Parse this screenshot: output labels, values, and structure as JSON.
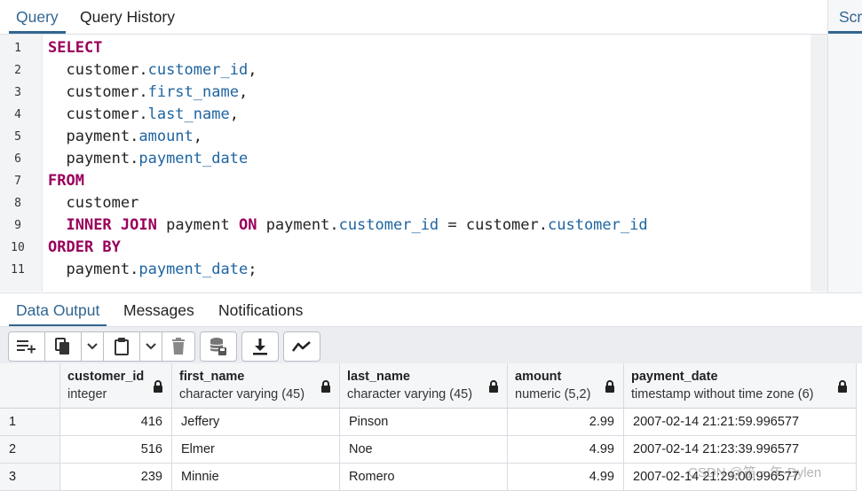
{
  "top_tabs": {
    "query": "Query",
    "history": "Query History",
    "scratch": "Scr"
  },
  "editor": {
    "line_numbers": [
      "1",
      "2",
      "3",
      "4",
      "5",
      "6",
      "7",
      "8",
      "9",
      "10",
      "11"
    ],
    "lines": [
      [
        {
          "t": "SELECT",
          "c": "kw"
        }
      ],
      [
        {
          "t": "  customer."
        },
        {
          "t": "customer_id",
          "c": "prop"
        },
        {
          "t": ","
        }
      ],
      [
        {
          "t": "  customer."
        },
        {
          "t": "first_name",
          "c": "prop"
        },
        {
          "t": ","
        }
      ],
      [
        {
          "t": "  customer."
        },
        {
          "t": "last_name",
          "c": "prop"
        },
        {
          "t": ","
        }
      ],
      [
        {
          "t": "  payment."
        },
        {
          "t": "amount",
          "c": "prop"
        },
        {
          "t": ","
        }
      ],
      [
        {
          "t": "  payment."
        },
        {
          "t": "payment_date",
          "c": "prop"
        }
      ],
      [
        {
          "t": "FROM",
          "c": "kw"
        }
      ],
      [
        {
          "t": "  customer"
        }
      ],
      [
        {
          "t": "  "
        },
        {
          "t": "INNER JOIN",
          "c": "kw"
        },
        {
          "t": " payment "
        },
        {
          "t": "ON",
          "c": "kw"
        },
        {
          "t": " payment."
        },
        {
          "t": "customer_id",
          "c": "prop"
        },
        {
          "t": " = customer."
        },
        {
          "t": "customer_id",
          "c": "prop"
        }
      ],
      [
        {
          "t": "ORDER BY",
          "c": "kw"
        }
      ],
      [
        {
          "t": "  payment."
        },
        {
          "t": "payment_date",
          "c": "prop"
        },
        {
          "t": ";"
        }
      ]
    ]
  },
  "bottom_tabs": {
    "data_output": "Data Output",
    "messages": "Messages",
    "notifications": "Notifications"
  },
  "toolbar": {
    "icons": [
      "add-row-icon",
      "copy-icon",
      "copy-dropdown-icon",
      "paste-icon",
      "paste-dropdown-icon",
      "delete-icon",
      "save-data-icon",
      "download-icon",
      "graph-icon"
    ]
  },
  "table": {
    "columns": [
      {
        "name": "customer_id",
        "type": "integer"
      },
      {
        "name": "first_name",
        "type": "character varying (45)"
      },
      {
        "name": "last_name",
        "type": "character varying (45)"
      },
      {
        "name": "amount",
        "type": "numeric (5,2)"
      },
      {
        "name": "payment_date",
        "type": "timestamp without time zone (6)"
      }
    ],
    "rows": [
      {
        "n": "1",
        "customer_id": "416",
        "first_name": "Jeffery",
        "last_name": "Pinson",
        "amount": "2.99",
        "payment_date": "2007-02-14 21:21:59.996577"
      },
      {
        "n": "2",
        "customer_id": "516",
        "first_name": "Elmer",
        "last_name": "Noe",
        "amount": "4.99",
        "payment_date": "2007-02-14 21:23:39.996577"
      },
      {
        "n": "3",
        "customer_id": "239",
        "first_name": "Minnie",
        "last_name": "Romero",
        "amount": "4.99",
        "payment_date": "2007-02-14 21:29:00.996577"
      }
    ]
  },
  "watermark": "CSDN @笛一年-Dylen",
  "colors": {
    "accent": "#326690",
    "keyword": "#99005a",
    "property": "#1e64a0"
  }
}
